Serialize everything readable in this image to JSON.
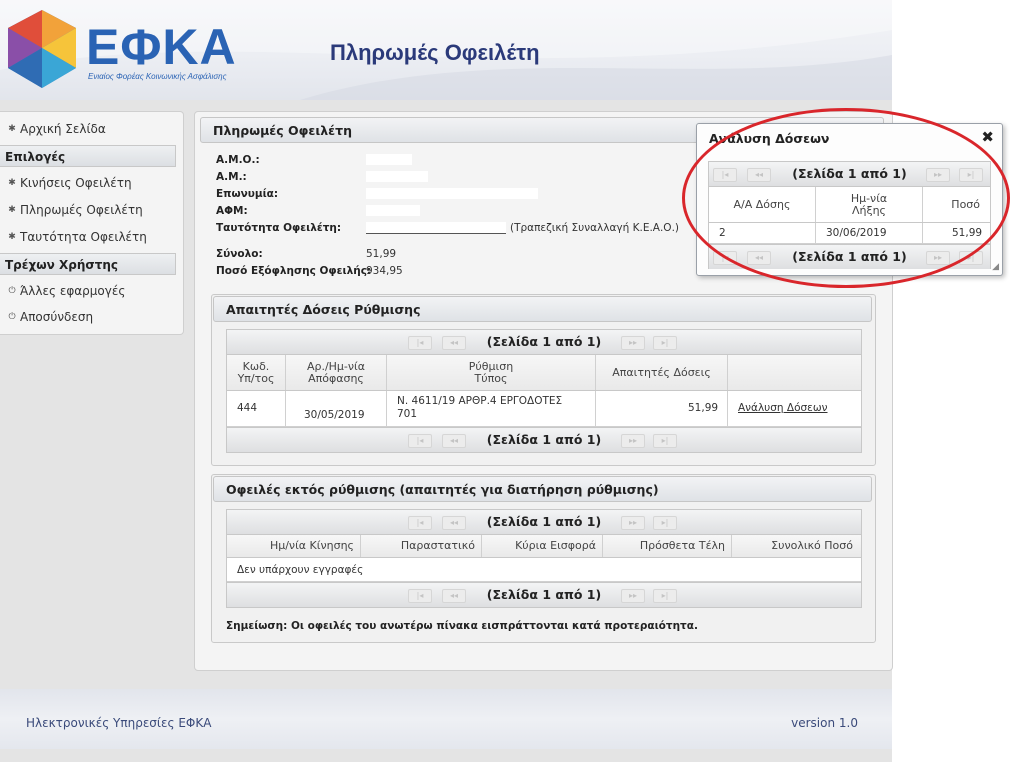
{
  "header": {
    "logo_text": "ΕΦΚΑ",
    "logo_subtitle": "Ενιαίος Φορέας Κοινωνικής Ασφάλισης",
    "page_heading": "Πληρωμές Οφειλέτη"
  },
  "sidebar": {
    "home": "Αρχική Σελίδα",
    "options_title": "Επιλογές",
    "movements": "Κινήσεις Οφειλέτη",
    "payments": "Πληρωμές Οφειλέτη",
    "identity": "Ταυτότητα Οφειλέτη",
    "current_user_title": "Τρέχων Χρήστης",
    "other_apps": "Άλλες εφαρμογές",
    "logout": "Αποσύνδεση",
    "icons": {
      "nav": "gear-icon",
      "session": "power-icon"
    }
  },
  "main": {
    "title": "Πληρωμές Οφειλέτη",
    "fields": {
      "amo_label": "Α.Μ.Ο.:",
      "am_label": "Α.Μ.:",
      "name_label": "Επωνυμία:",
      "afm_label": "ΑΦΜ:",
      "identity_label": "Ταυτότητα Οφειλέτη:",
      "identity_suffix": "(Τραπεζική Συναλλαγή Κ.Ε.Α.Ο.)",
      "total_label": "Σύνολο:",
      "total_value": "51,99",
      "payoff_label": "Ποσό Εξόφλησης Οφειλής:",
      "payoff_value": "934,95"
    }
  },
  "installments": {
    "title": "Απαιτητές Δόσεις Ρύθμισης",
    "pager": "(Σελίδα 1 από 1)",
    "columns": [
      "Κωδ.\nΥπ/τος",
      "Αρ./Ημ-νία\nΑπόφασης",
      "Ρύθμιση\nΤύπος",
      "Απαιτητές Δόσεις",
      ""
    ],
    "row": {
      "code": "444",
      "decision_date": "30/05/2019",
      "type_line1": "Ν. 4611/19 ΑΡΘΡ.4 ΕΡΓΟΔΟΤΕΣ",
      "type_line2": "701",
      "amount": "51,99",
      "action": "Ανάλυση Δόσεων"
    }
  },
  "outside": {
    "title": "Οφειλές εκτός ρύθμισης (απαιτητές για διατήρηση ρύθμισης)",
    "pager": "(Σελίδα 1 από 1)",
    "columns": [
      "Ημ/νία Κίνησης",
      "Παραστατικό",
      "Κύρια Εισφορά",
      "Πρόσθετα Τέλη",
      "Συνολικό Ποσό"
    ],
    "empty": "Δεν υπάρχουν εγγραφές",
    "note": "Σημείωση: Οι οφειλές του ανωτέρω πίνακα εισπράττονται κατά προτεραιότητα."
  },
  "dialog": {
    "title": "Ανάλυση Δόσεων",
    "pager": "(Σελίδα 1 από 1)",
    "columns": [
      "Α/Α Δόσης",
      "Ημ-νία\nΛήξης",
      "Ποσό"
    ],
    "row": {
      "no": "2",
      "due": "30/06/2019",
      "amount": "51,99"
    }
  },
  "footer": {
    "left": "Ηλεκτρονικές Υπηρεσίες ΕΦΚΑ",
    "right": "version 1.0"
  },
  "colors": {
    "annotation": "#d9262b",
    "brand": "#2a63b4",
    "heading": "#2b3a7a"
  }
}
